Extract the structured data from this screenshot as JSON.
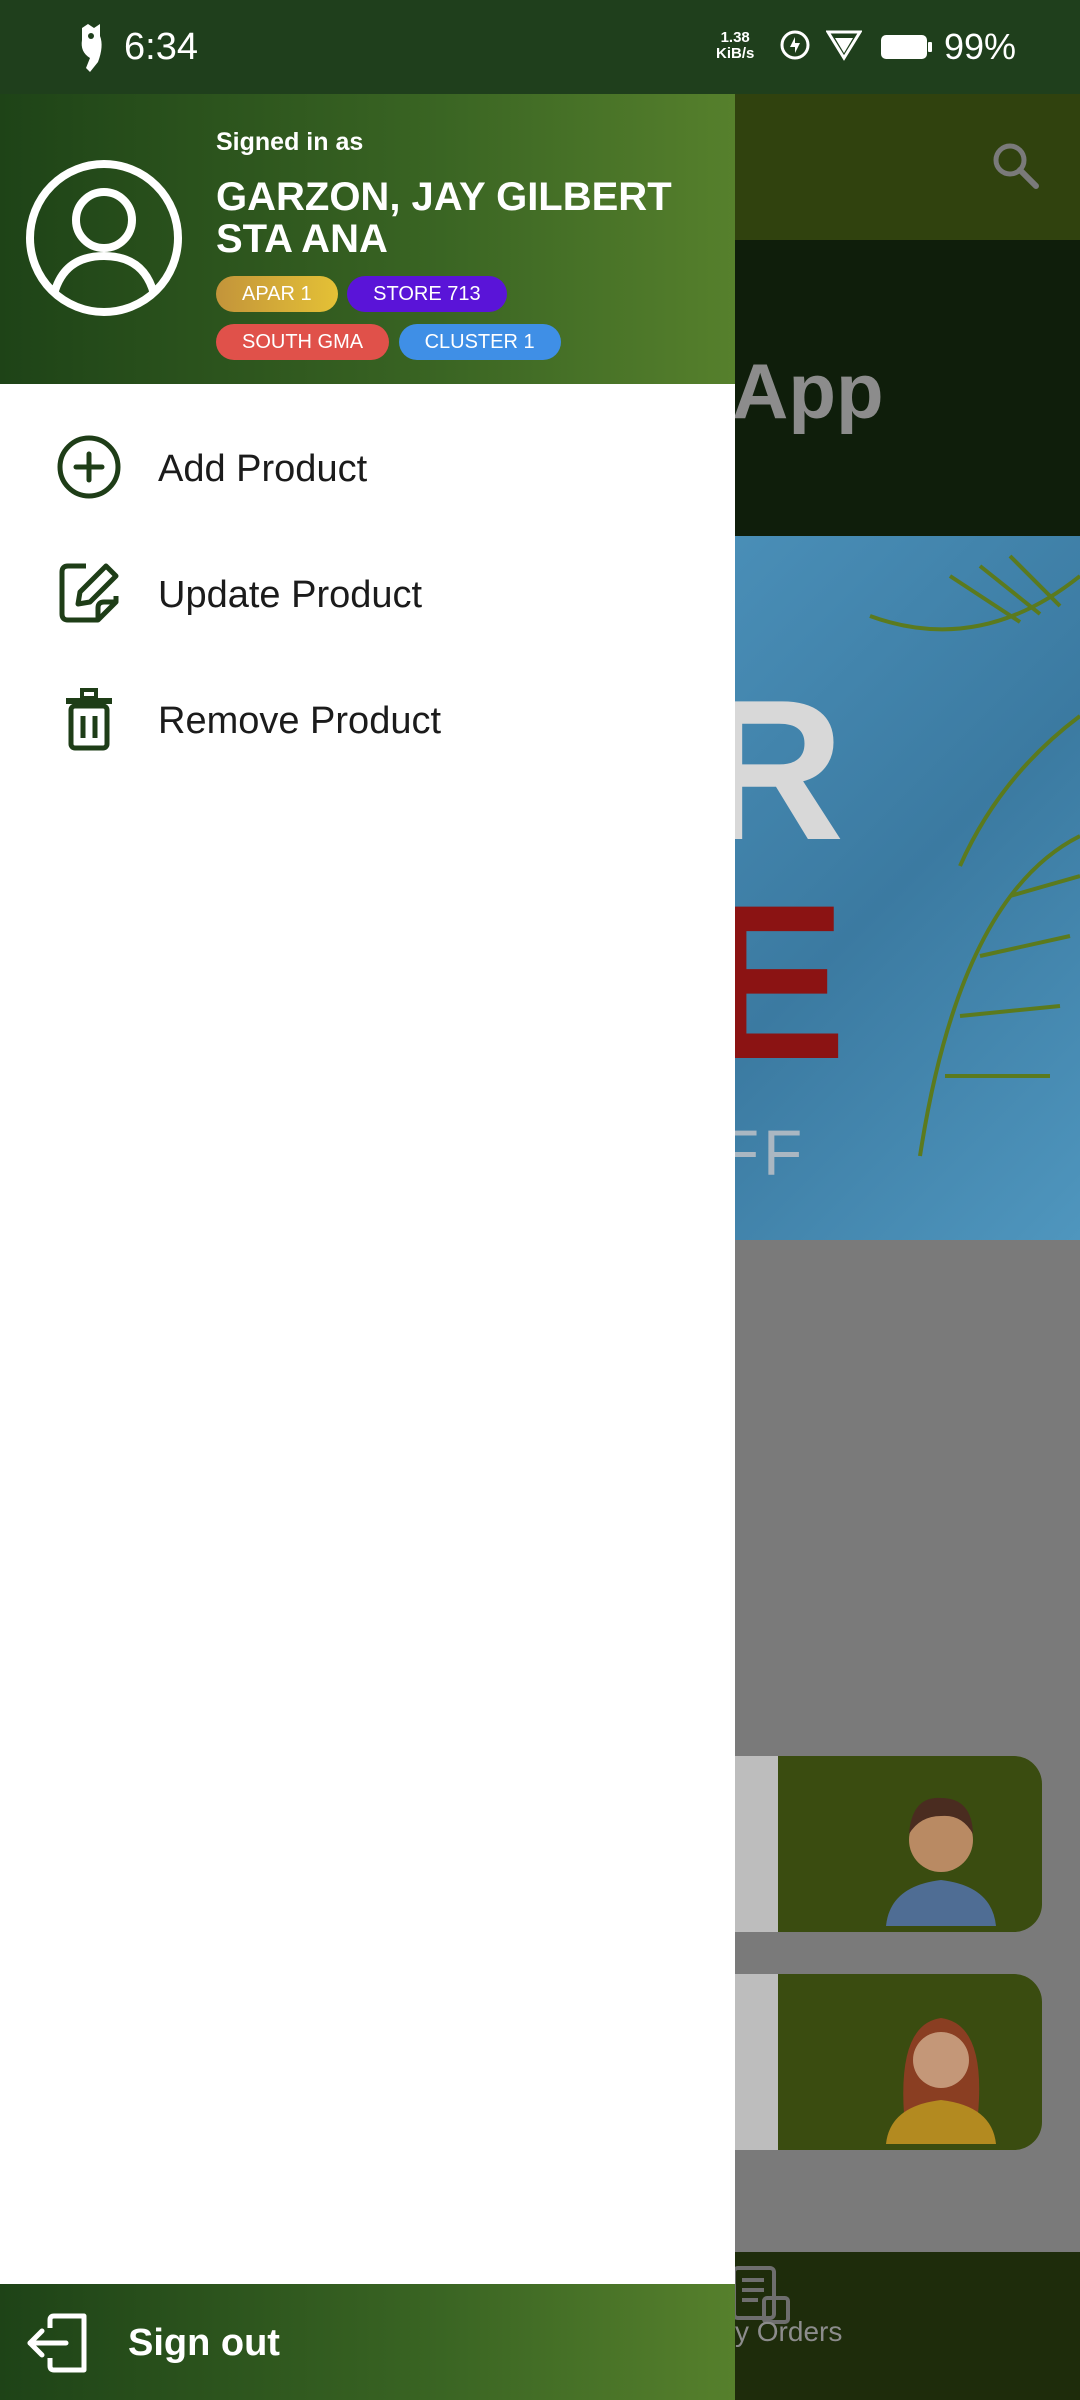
{
  "status_bar": {
    "time": "6:34",
    "net_speed_value": "1.38",
    "net_speed_unit": "KiB/s",
    "battery": "99%"
  },
  "background_app": {
    "hero_title_fragment": "App",
    "banner_text_1": "R",
    "banner_text_2": "E",
    "banner_text_3": "FF",
    "bottom_nav_label": "y Orders"
  },
  "drawer": {
    "signed_in_label": "Signed in as",
    "user_name": "GARZON, JAY GILBERT STA ANA",
    "chips": [
      {
        "label": "APAR 1",
        "color": "#d4a52e"
      },
      {
        "label": "STORE 713",
        "color": "#5a14d8"
      },
      {
        "label": "SOUTH GMA",
        "color": "#e0514a"
      },
      {
        "label": "CLUSTER 1",
        "color": "#3f8fe6"
      }
    ],
    "menu": [
      {
        "label": "Add Product",
        "icon": "add-circle-icon"
      },
      {
        "label": "Update Product",
        "icon": "edit-icon"
      },
      {
        "label": "Remove Product",
        "icon": "trash-icon"
      }
    ],
    "sign_out_label": "Sign out"
  },
  "colors": {
    "brand_green": "#1e4317",
    "brand_green_light": "#56802c",
    "icon_green": "#1e3d17"
  }
}
